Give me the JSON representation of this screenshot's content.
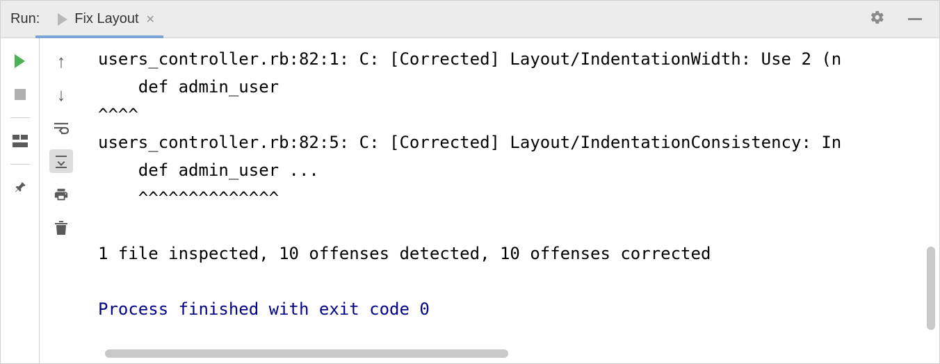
{
  "header": {
    "run_label": "Run:",
    "tab": {
      "label": "Fix Layout"
    }
  },
  "console": {
    "lines": [
      {
        "text": "users_controller.rb:82:1: C: [Corrected] Layout/IndentationWidth: Use 2 (n",
        "cls": ""
      },
      {
        "text": "    def admin_user",
        "cls": ""
      },
      {
        "text": "^^^^",
        "cls": ""
      },
      {
        "text": "users_controller.rb:82:5: C: [Corrected] Layout/IndentationConsistency: In",
        "cls": ""
      },
      {
        "text": "    def admin_user ...",
        "cls": ""
      },
      {
        "text": "    ^^^^^^^^^^^^^^",
        "cls": ""
      },
      {
        "text": "",
        "cls": ""
      },
      {
        "text": "1 file inspected, 10 offenses detected, 10 offenses corrected",
        "cls": ""
      },
      {
        "text": "",
        "cls": ""
      },
      {
        "text": "Process finished with exit code 0",
        "cls": "exit-line"
      }
    ]
  }
}
